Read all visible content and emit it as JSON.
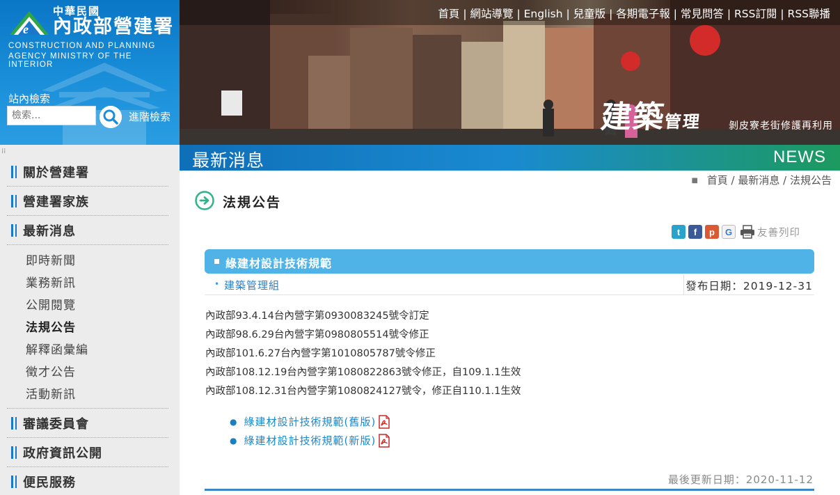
{
  "site": {
    "name_small": "中華民國",
    "name_main": "內政部營建署",
    "name_en_1": "CONSTRUCTION AND PLANNING",
    "name_en_2": "AGENCY MINISTRY OF THE INTERIOR"
  },
  "search": {
    "label": "站內檢索",
    "placeholder": "檢索...",
    "advanced": "進階檢索"
  },
  "topnav": {
    "items": [
      "首頁",
      "網站導覽",
      "English",
      "兒童版",
      "各期電子報",
      "常見問答",
      "RSS訂閱",
      "RSS聯播"
    ]
  },
  "banner": {
    "callig_big": "建築",
    "callig_small": "管理",
    "caption": "剝皮寮老街修護再利用"
  },
  "sidebar": {
    "groups": [
      {
        "label": "關於營建署"
      },
      {
        "label": "營建署家族"
      },
      {
        "label": "最新消息",
        "subs": [
          "即時新聞",
          "業務新訊",
          "公開閱覽",
          "法規公告",
          "解釋函彙編",
          "徵才公告",
          "活動新訊"
        ]
      },
      {
        "label": "審議委員會"
      },
      {
        "label": "政府資訊公開"
      },
      {
        "label": "便民服務"
      }
    ],
    "active_sub": "法規公告"
  },
  "titlebar": {
    "zh": "最新消息",
    "en": "NEWS"
  },
  "breadcrumb": {
    "items": [
      "首頁",
      "最新消息",
      "法規公告"
    ]
  },
  "section": {
    "title": "法規公告"
  },
  "share": {
    "twitter": "t",
    "facebook": "f",
    "plurk": "p",
    "google": "G",
    "print_label": "友善列印"
  },
  "article": {
    "title": "綠建材設計技術規範",
    "unit": "建築管理組",
    "date_label": "發布日期：2019-12-31",
    "lines": [
      "內政部93.4.14台內營字第0930083245號令訂定",
      "內政部98.6.29台內營字第0980805514號令修正",
      "內政部101.6.27台內營字第1010805787號令修正",
      "內政部108.12.19台內營字第1080822863號令修正，自109.1.1生效",
      "內政部108.12.31台內營字第1080824127號令，修正自110.1.1生效"
    ],
    "files": [
      "綠建材設計技術規範(舊版)",
      "綠建材設計技術規範(新版)"
    ],
    "last_update": "最後更新日期：2020-11-12"
  },
  "colors": {
    "brand_blue": "#0a76c6",
    "article_head": "#4fb3e8",
    "link": "#1a88cf",
    "accent_green": "#1d9a5f"
  }
}
